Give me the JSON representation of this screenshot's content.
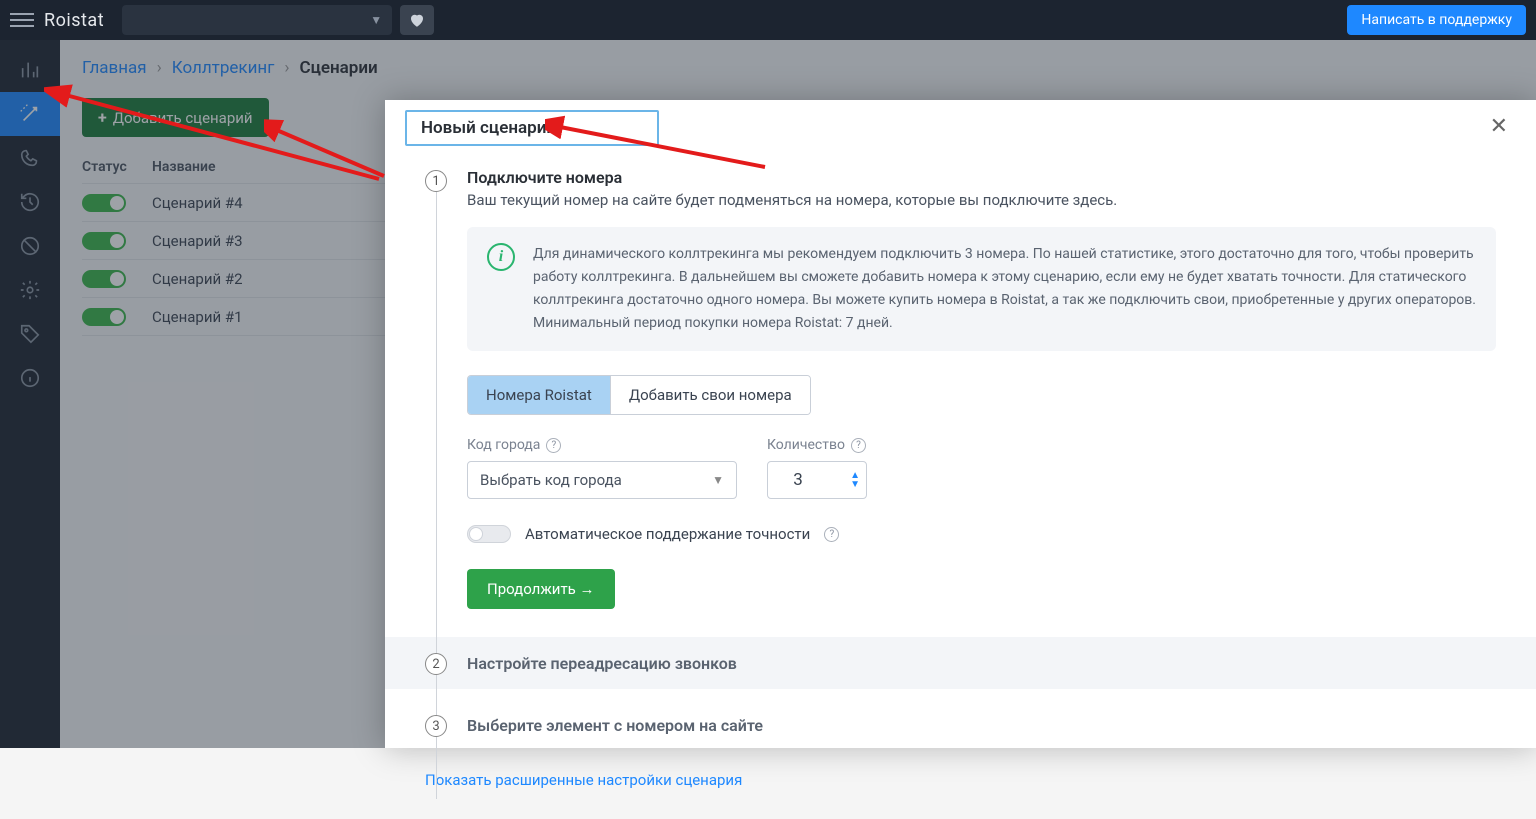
{
  "topbar": {
    "logo": "Roistat",
    "support_button": "Написать в поддержку"
  },
  "breadcrumbs": {
    "home": "Главная",
    "calltracking": "Коллтрекинг",
    "current": "Сценарии"
  },
  "buttons": {
    "add_scenario": "Добавить сценарий"
  },
  "table": {
    "headers": {
      "status": "Статус",
      "name": "Название"
    },
    "rows": [
      {
        "name": "Сценарий #4"
      },
      {
        "name": "Сценарий #3"
      },
      {
        "name": "Сценарий #2"
      },
      {
        "name": "Сценарий #1"
      }
    ]
  },
  "modal": {
    "title": "Новый сценарий",
    "step1": {
      "title": "Подключите номера",
      "sub": "Ваш текущий номер на сайте будет подменяться на номера, которые вы подключите здесь.",
      "info": "Для динамического коллтрекинга мы рекомендуем подключить 3 номера. По нашей статистике, этого достаточно для того, чтобы проверить работу коллтрекинга. В дальнейшем вы сможете добавить номера к этому сценарию, если ему не будет хватать точности. Для статического коллтрекинга достаточно одного номера. Вы можете купить номера в Roistat, а так же подключить свои, приобретенные у других операторов. Минимальный период покупки номера Roistat: 7 дней.",
      "tab_roistat": "Номера Roistat",
      "tab_own": "Добавить свои номера",
      "city_label": "Код города",
      "city_placeholder": "Выбрать код города",
      "qty_label": "Количество",
      "qty_value": "3",
      "auto_label": "Автоматическое поддержание точности",
      "continue": "Продолжить →"
    },
    "step2": {
      "title": "Настройте переадресацию звонков"
    },
    "step3": {
      "title": "Выберите элемент с номером на сайте"
    },
    "advanced": "Показать расширенные настройки сценария"
  }
}
